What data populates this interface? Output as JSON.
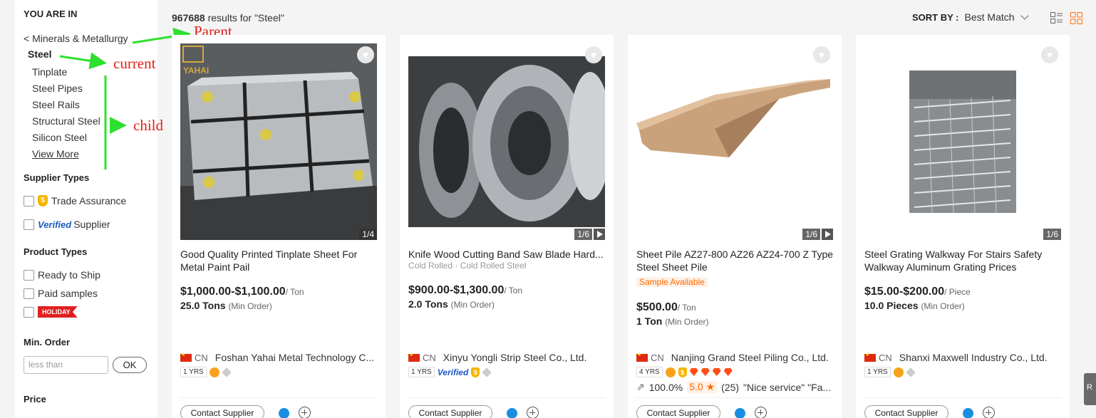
{
  "sidebar": {
    "title": "YOU ARE IN",
    "parent": "< Minerals & Metallurgy",
    "current": "Steel",
    "children": [
      "Tinplate",
      "Steel Pipes",
      "Steel Rails",
      "Structural Steel",
      "Silicon Steel"
    ],
    "view_more": "View More",
    "supplier_types": {
      "title": "Supplier Types",
      "trade_assurance": "Trade Assurance",
      "verified_badge": "Verified",
      "verified_label": "Supplier"
    },
    "product_types": {
      "title": "Product Types",
      "ready_to_ship": "Ready to Ship",
      "paid_samples": "Paid samples",
      "holiday": "HOLIDAY"
    },
    "min_order": {
      "title": "Min. Order",
      "placeholder": "less than",
      "ok": "OK"
    },
    "price": {
      "title": "Price"
    }
  },
  "annotations": {
    "parent": "Parent",
    "current": "current",
    "child": "child",
    "color": "#e0201a",
    "arrow_color": "#2ee02e"
  },
  "header": {
    "results_count": "967688",
    "results_text": " results for \"Steel\"",
    "sort_label": "SORT BY :",
    "sort_value": "Best Match"
  },
  "products": [
    {
      "counter": "1/4",
      "title": "Good Quality Printed Tinplate Sheet For Metal Paint Pail",
      "price": "$1,000.00-$1,100.00",
      "price_unit": "/ Ton",
      "moq": "25.0 Tons",
      "moq_unit": "(Min Order)",
      "country": "CN",
      "supplier": "Foshan Yahai Metal Technology C...",
      "years": "1 YRS",
      "contact": "Contact Supplier",
      "logo": "YAHAI"
    },
    {
      "counter": "1/6",
      "title": "Knife Wood Cutting Band Saw Blade Hard...",
      "attrs": "Cold Rolled · Cold Rolled Steel",
      "price": "$900.00-$1,300.00",
      "price_unit": "/ Ton",
      "moq": "2.0 Tons",
      "moq_unit": "(Min Order)",
      "country": "CN",
      "supplier": "Xinyu Yongli Strip Steel Co., Ltd.",
      "years": "1 YRS",
      "verified": "Verified",
      "contact": "Contact Supplier"
    },
    {
      "counter": "1/6",
      "title": "Sheet Pile AZ27-800 AZ26 AZ24-700 Z Type Steel Sheet Pile",
      "sample": "Sample Available",
      "price": "$500.00",
      "price_unit": "/ Ton",
      "moq": "1 Ton",
      "moq_unit": "(Min Order)",
      "country": "CN",
      "supplier": "Nanjing Grand Steel Piling Co., Ltd.",
      "years": "4 YRS",
      "response_rate": "100.0%",
      "score": "5.0 ★",
      "reviews": "(25)",
      "review_snippet": "\"Nice service\"  \"Fa...",
      "contact": "Contact Supplier"
    },
    {
      "counter": "1/6",
      "title": "Steel Grating Walkway For Stairs Safety Walkway Aluminum Grating Prices",
      "price": "$15.00-$200.00",
      "price_unit": "/ Piece",
      "moq": "10.0 Pieces",
      "moq_unit": "(Min Order)",
      "country": "CN",
      "supplier": "Shanxi Maxwell Industry Co., Ltd.",
      "years": "1 YRS",
      "contact": "Contact Supplier"
    }
  ],
  "edge_button": "R"
}
